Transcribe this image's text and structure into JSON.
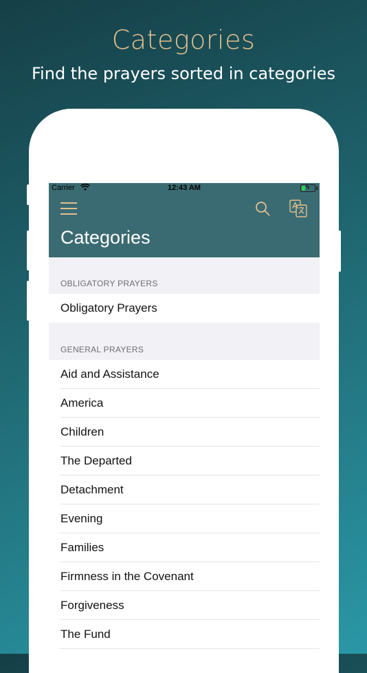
{
  "promo": {
    "title": "Categories",
    "subtitle": "Find the prayers sorted in categories"
  },
  "status_bar": {
    "carrier": "Carrier",
    "time": "12:43 AM"
  },
  "app_bar": {
    "title": "Categories",
    "icons": [
      "menu-icon",
      "search-icon",
      "translate-icon"
    ],
    "accent_color": "#e3c08e",
    "bar_color": "#3b6b72"
  },
  "sections": [
    {
      "header": "OBLIGATORY PRAYERS",
      "items": [
        "Obligatory Prayers"
      ]
    },
    {
      "header": "GENERAL PRAYERS",
      "items": [
        "Aid and Assistance",
        "America",
        "Children",
        "The Departed",
        "Detachment",
        "Evening",
        "Families",
        "Firmness in the Covenant",
        "Forgiveness",
        "The Fund"
      ]
    }
  ]
}
